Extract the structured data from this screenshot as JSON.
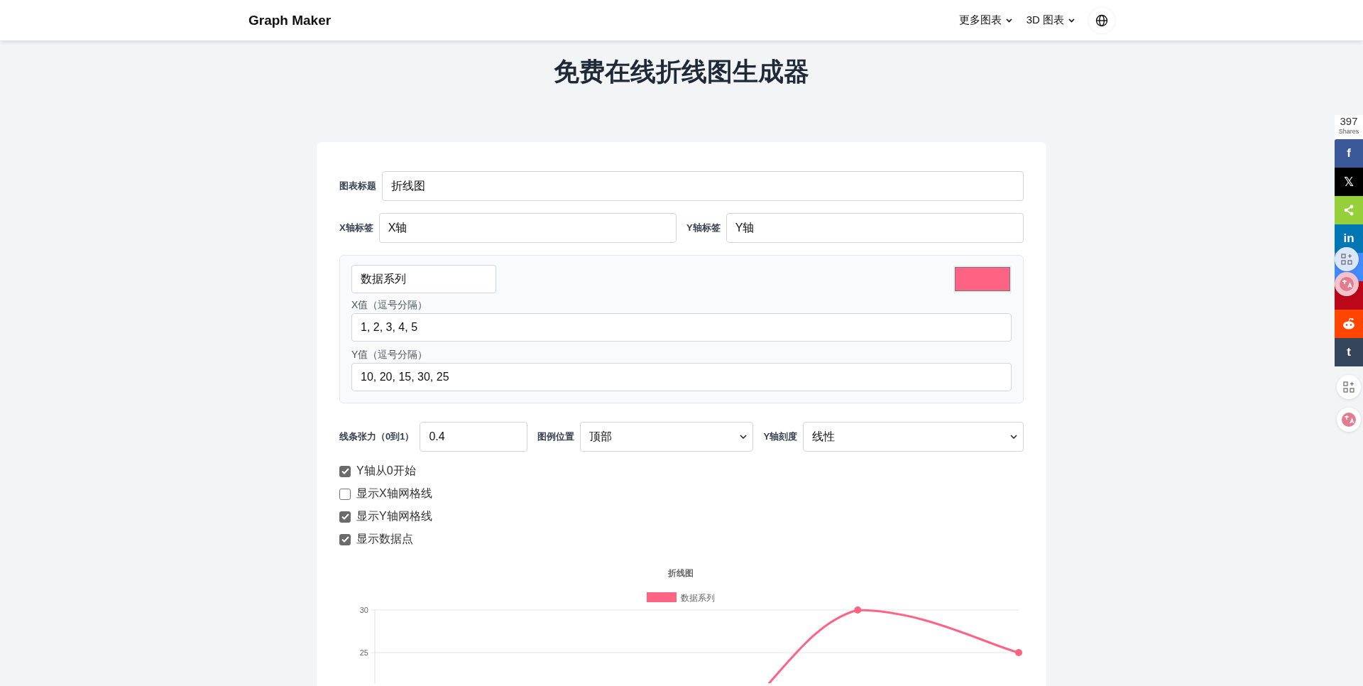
{
  "header": {
    "logo": "Graph Maker",
    "nav": [
      {
        "label": "更多图表"
      },
      {
        "label": "3D 图表"
      }
    ]
  },
  "page_title": "免费在线折线图生成器",
  "form": {
    "chart_title": {
      "label": "图表标题",
      "value": "折线图"
    },
    "x_label": {
      "label": "X轴标签",
      "value": "X轴"
    },
    "y_label": {
      "label": "Y轴标签",
      "value": "Y轴"
    },
    "series": {
      "name": "数据系列",
      "color": "#ff6384",
      "x_values_label": "X值（逗号分隔）",
      "x_values": "1, 2, 3, 4, 5",
      "y_values_label": "Y值（逗号分隔）",
      "y_values": "10, 20, 15, 30, 25"
    },
    "tension": {
      "label": "线条张力（0到1）",
      "value": "0.4"
    },
    "legend_position": {
      "label": "图例位置",
      "value": "顶部"
    },
    "y_scale": {
      "label": "Y轴刻度",
      "value": "线性"
    },
    "checkboxes": [
      {
        "label": "Y轴从0开始",
        "checked": true
      },
      {
        "label": "显示X轴网格线",
        "checked": false
      },
      {
        "label": "显示Y轴网格线",
        "checked": true
      },
      {
        "label": "显示数据点",
        "checked": true
      }
    ],
    "chart": {
      "title": "折线图",
      "legend_label": "数据系列",
      "y_tick_labels": [
        "30",
        "25"
      ]
    }
  },
  "share_bar": {
    "count": "397",
    "count_label": "Shares",
    "buttons": [
      {
        "kind": "facebook",
        "glyph": "f"
      },
      {
        "kind": "x",
        "glyph": "𝕏"
      },
      {
        "kind": "share"
      },
      {
        "kind": "linkedin",
        "glyph": "in"
      },
      {
        "kind": "messenger"
      },
      {
        "kind": "pinterest"
      },
      {
        "kind": "reddit"
      },
      {
        "kind": "tumblr",
        "glyph": "t"
      }
    ]
  }
}
